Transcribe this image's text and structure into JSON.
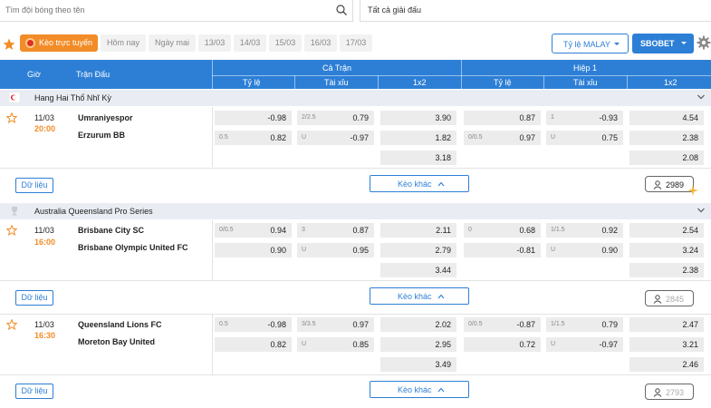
{
  "search": {
    "placeholder": "Tìm đội bóng theo tên"
  },
  "league_filter": {
    "value": "Tất cả giải đấu"
  },
  "toolbar": {
    "live_label": "Kèo trực tuyến",
    "dates": [
      "Hôm nay",
      "Ngày mai",
      "13/03",
      "14/03",
      "15/03",
      "16/03",
      "17/03"
    ],
    "odds_type": "Tỷ lệ MALAY",
    "bookmaker": "SBOBET"
  },
  "header": {
    "time": "Giờ",
    "match": "Trận Đấu",
    "full_time": "Cả Trận",
    "first_half": "Hiệp 1",
    "handicap": "Tỷ lệ",
    "over_under": "Tài xỉu",
    "one_x_two": "1x2"
  },
  "labels": {
    "data": "Dữ liệu",
    "more_odds": "Kèo khác"
  },
  "colors": {
    "primary": "#2d7fd6",
    "accent": "#f28c28",
    "live_dot": "#e0301e"
  },
  "leagues": [
    {
      "name": "Hang Hai Thổ Nhĩ Kỳ",
      "matches": [
        {
          "date": "11/03",
          "time": "20:00",
          "home": "Umraniyespor",
          "away": "Erzurum BB",
          "ft_hdp": [
            {
              "line": "",
              "odd": "-0.98"
            },
            {
              "line": "0.5",
              "odd": "0.82"
            }
          ],
          "ft_ou": [
            {
              "line": "2/2.5",
              "odd": "0.79"
            },
            {
              "line": "U",
              "odd": "-0.97"
            }
          ],
          "ft_1x2": [
            "3.90",
            "1.82",
            "3.18"
          ],
          "h1_hdp": [
            {
              "line": "",
              "odd": "0.87"
            },
            {
              "line": "0/0.5",
              "odd": "0.97"
            }
          ],
          "h1_ou": [
            {
              "line": "1",
              "odd": "-0.93"
            },
            {
              "line": "U",
              "odd": "0.75"
            }
          ],
          "h1_1x2": [
            "4.54",
            "2.38",
            "2.08"
          ],
          "votes": "2989"
        }
      ]
    },
    {
      "name": "Australia Queensland Pro Series",
      "matches": [
        {
          "date": "11/03",
          "time": "16:00",
          "home": "Brisbane City SC",
          "away": "Brisbane Olympic United FC",
          "ft_hdp": [
            {
              "line": "0/0.5",
              "odd": "0.94"
            },
            {
              "line": "",
              "odd": "0.90"
            }
          ],
          "ft_ou": [
            {
              "line": "3",
              "odd": "0.87"
            },
            {
              "line": "U",
              "odd": "0.95"
            }
          ],
          "ft_1x2": [
            "2.11",
            "2.79",
            "3.44"
          ],
          "h1_hdp": [
            {
              "line": "0",
              "odd": "0.68"
            },
            {
              "line": "",
              "odd": "-0.81"
            }
          ],
          "h1_ou": [
            {
              "line": "1/1.5",
              "odd": "0.92"
            },
            {
              "line": "U",
              "odd": "0.90"
            }
          ],
          "h1_1x2": [
            "2.54",
            "3.24",
            "2.38"
          ],
          "votes": "2845"
        },
        {
          "date": "11/03",
          "time": "16:30",
          "home": "Queensland Lions FC",
          "away": "Moreton Bay United",
          "ft_hdp": [
            {
              "line": "0.5",
              "odd": "-0.98"
            },
            {
              "line": "",
              "odd": "0.82"
            }
          ],
          "ft_ou": [
            {
              "line": "3/3.5",
              "odd": "0.97"
            },
            {
              "line": "U",
              "odd": "0.85"
            }
          ],
          "ft_1x2": [
            "2.02",
            "2.95",
            "3.49"
          ],
          "h1_hdp": [
            {
              "line": "0/0.5",
              "odd": "-0.87"
            },
            {
              "line": "",
              "odd": "0.72"
            }
          ],
          "h1_ou": [
            {
              "line": "1/1.5",
              "odd": "0.79"
            },
            {
              "line": "U",
              "odd": "-0.97"
            }
          ],
          "h1_1x2": [
            "2.47",
            "3.21",
            "2.46"
          ],
          "votes": "2793"
        }
      ]
    }
  ]
}
